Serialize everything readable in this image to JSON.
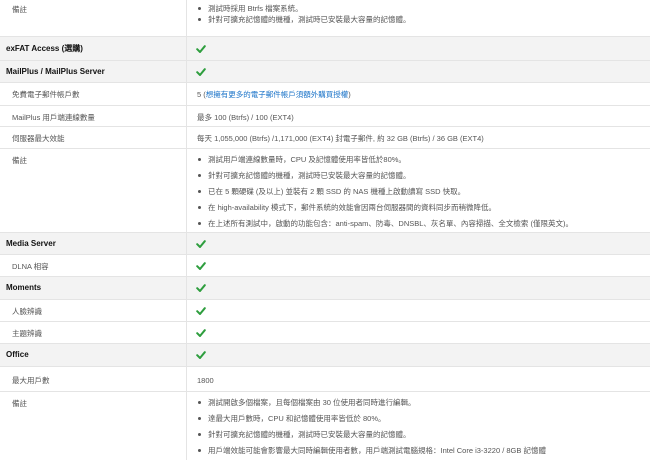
{
  "rows": {
    "r0": {
      "label": "備註",
      "bullets": [
        "測試時採用 Btrfs 檔案系統。",
        "針對可擴充記憶體的機種，測試時已安裝最大容量的記憶體。"
      ]
    },
    "r1": {
      "label": "exFAT Access (選購)"
    },
    "r2": {
      "label": "MailPlus / MailPlus Server"
    },
    "r3": {
      "label": "免費電子郵件帳戶數",
      "value_prefix": "5 (",
      "value_link": "想擁有更多的電子郵件帳戶須額外購買授權",
      "value_suffix": ")"
    },
    "r4": {
      "label": "MailPlus 用戶端連線數量",
      "value": "最多 100 (Btrfs) / 100 (EXT4)"
    },
    "r5": {
      "label": "伺服器最大效能",
      "value": "每天 1,055,000 (Btrfs) /1,171,000 (EXT4) 封電子郵件, 約 32 GB (Btrfs) / 36 GB (EXT4)"
    },
    "r6": {
      "label": "備註",
      "bullets": [
        "測試用戶端連線數量時，CPU 及記憶體使用率皆低於80%。",
        "針對可擴充記憶體的機種，測試時已安裝最大容量的記憶體。",
        "已在 5 顆硬碟 (及以上) 並裝有 2 顆 SSD 的 NAS 機種上啟動讀寫 SSD 快取。",
        "在 high-availability 模式下，郵件系統的效能會因兩台伺服器間的資料同步而稍微降低。",
        "在上述所有測試中，啟動的功能包含：anti-spam、防毒、DNSBL、灰名單、內容掃描、全文檢索 (僅限英文)。"
      ]
    },
    "r7": {
      "label": "Media Server"
    },
    "r8": {
      "label": "DLNA 相容"
    },
    "r9": {
      "label": "Moments"
    },
    "r10": {
      "label": "人臉辨識"
    },
    "r11": {
      "label": "主題辨識"
    },
    "r12": {
      "label": "Office"
    },
    "r13": {
      "label": "最大用戶數",
      "value": "1800"
    },
    "r14": {
      "label": "備註",
      "bullets": [
        "測試開啟多個檔案，且每個檔案由 30 位使用者同時進行編輯。",
        "達最大用戶數時，CPU 和記憶體使用率皆低於 80%。",
        "針對可擴充記憶體的機種，測試時已安裝最大容量的記憶體。",
        "用戶端效能可能會影響最大同時編輯使用者數，用戶端測試電腦規格：Intel Core i3-3220 / 8GB 記憶體"
      ]
    }
  },
  "colors": {
    "check": "#2e9e3e",
    "link": "#1a73c8",
    "header_bg": "#f3f3f3",
    "border": "#e4e4e4"
  },
  "icons": {
    "check": "checkmark-icon"
  }
}
